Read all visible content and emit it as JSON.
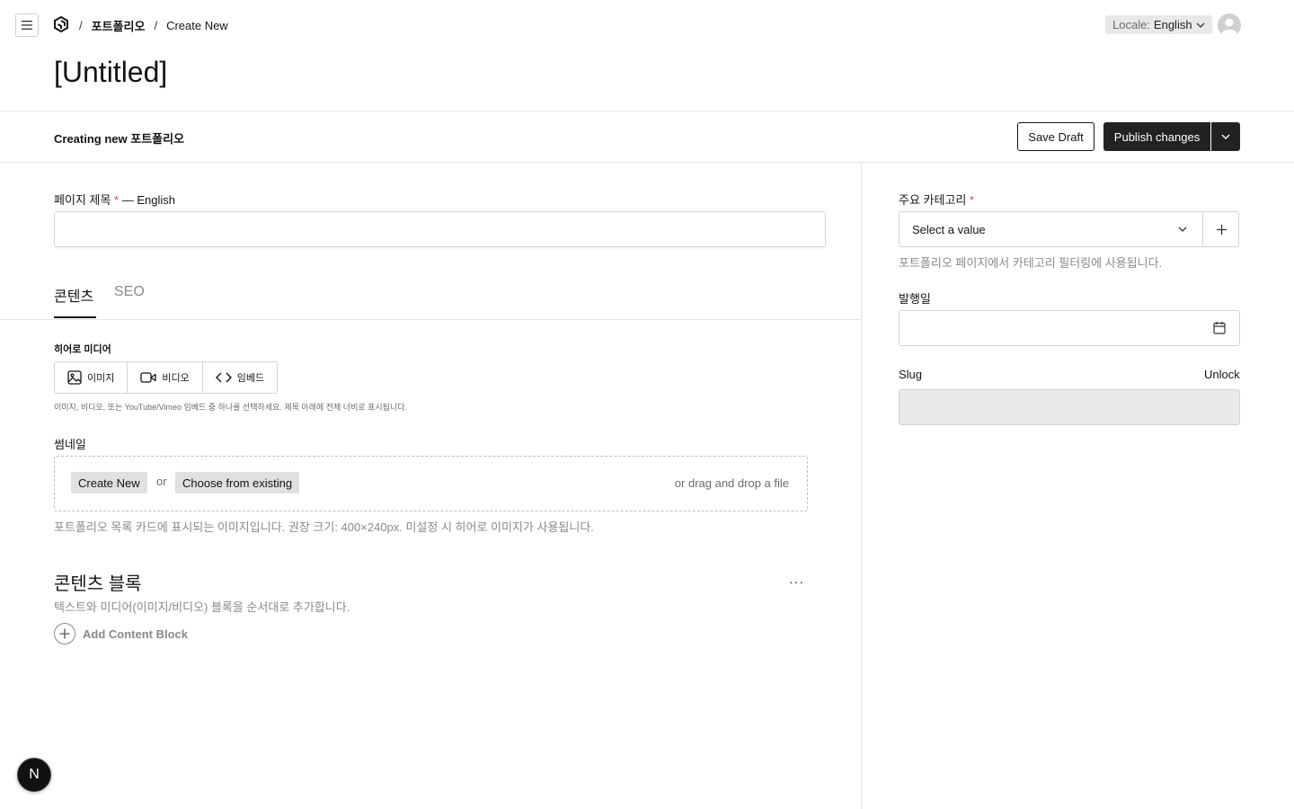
{
  "header": {
    "breadcrumbs": [
      {
        "label": "포트폴리오"
      },
      {
        "label": "Create New"
      }
    ],
    "breadcrumb_separator": "/",
    "locale_label": "Locale:",
    "locale_value": "English"
  },
  "page": {
    "title": "[Untitled]"
  },
  "doc_controls": {
    "status_text": "Creating new 포트폴리오",
    "save_draft_label": "Save Draft",
    "publish_label": "Publish changes"
  },
  "main": {
    "title_field": {
      "label": "페이지 제목",
      "required_mark": "*",
      "locale_suffix": "— English",
      "value": ""
    },
    "tabs": [
      {
        "label": "콘텐츠",
        "active": true
      },
      {
        "label": "SEO",
        "active": false
      }
    ],
    "hero_media": {
      "label": "히어로 미디어",
      "options": [
        {
          "label": "이미지",
          "icon": "image-icon"
        },
        {
          "label": "비디오",
          "icon": "video-icon"
        },
        {
          "label": "임베드",
          "icon": "code-icon"
        }
      ],
      "description": "이미지, 비디오, 또는 YouTube/Vimeo 임베드 중 하나를 선택하세요. 제목 아래에 전체 너비로 표시됩니다."
    },
    "thumbnail": {
      "label": "썸네일",
      "create_new_label": "Create New",
      "or_label": "or",
      "choose_existing_label": "Choose from existing",
      "drag_drop_label": "or drag and drop a file",
      "description": "포트폴리오 목록 카드에 표시되는 이미지입니다. 권장 크기: 400×240px. 미설정 시 히어로 이미지가 사용됩니다."
    },
    "content_blocks": {
      "title": "콘텐츠 블록",
      "more_label": "···",
      "description": "텍스트와 미디어(이미지/비디오) 블록을 순서대로 추가합니다.",
      "add_label": "Add Content Block"
    }
  },
  "sidebar": {
    "category": {
      "label": "주요 카테고리",
      "required_mark": "*",
      "placeholder": "Select a value",
      "description": "포트폴리오 페이지에서 카테고리 필터링에 사용됩니다."
    },
    "publish_date": {
      "label": "발행일",
      "value": ""
    },
    "slug": {
      "label": "Slug",
      "unlock_label": "Unlock",
      "value": ""
    }
  },
  "dev_badge": {
    "label": "N"
  }
}
